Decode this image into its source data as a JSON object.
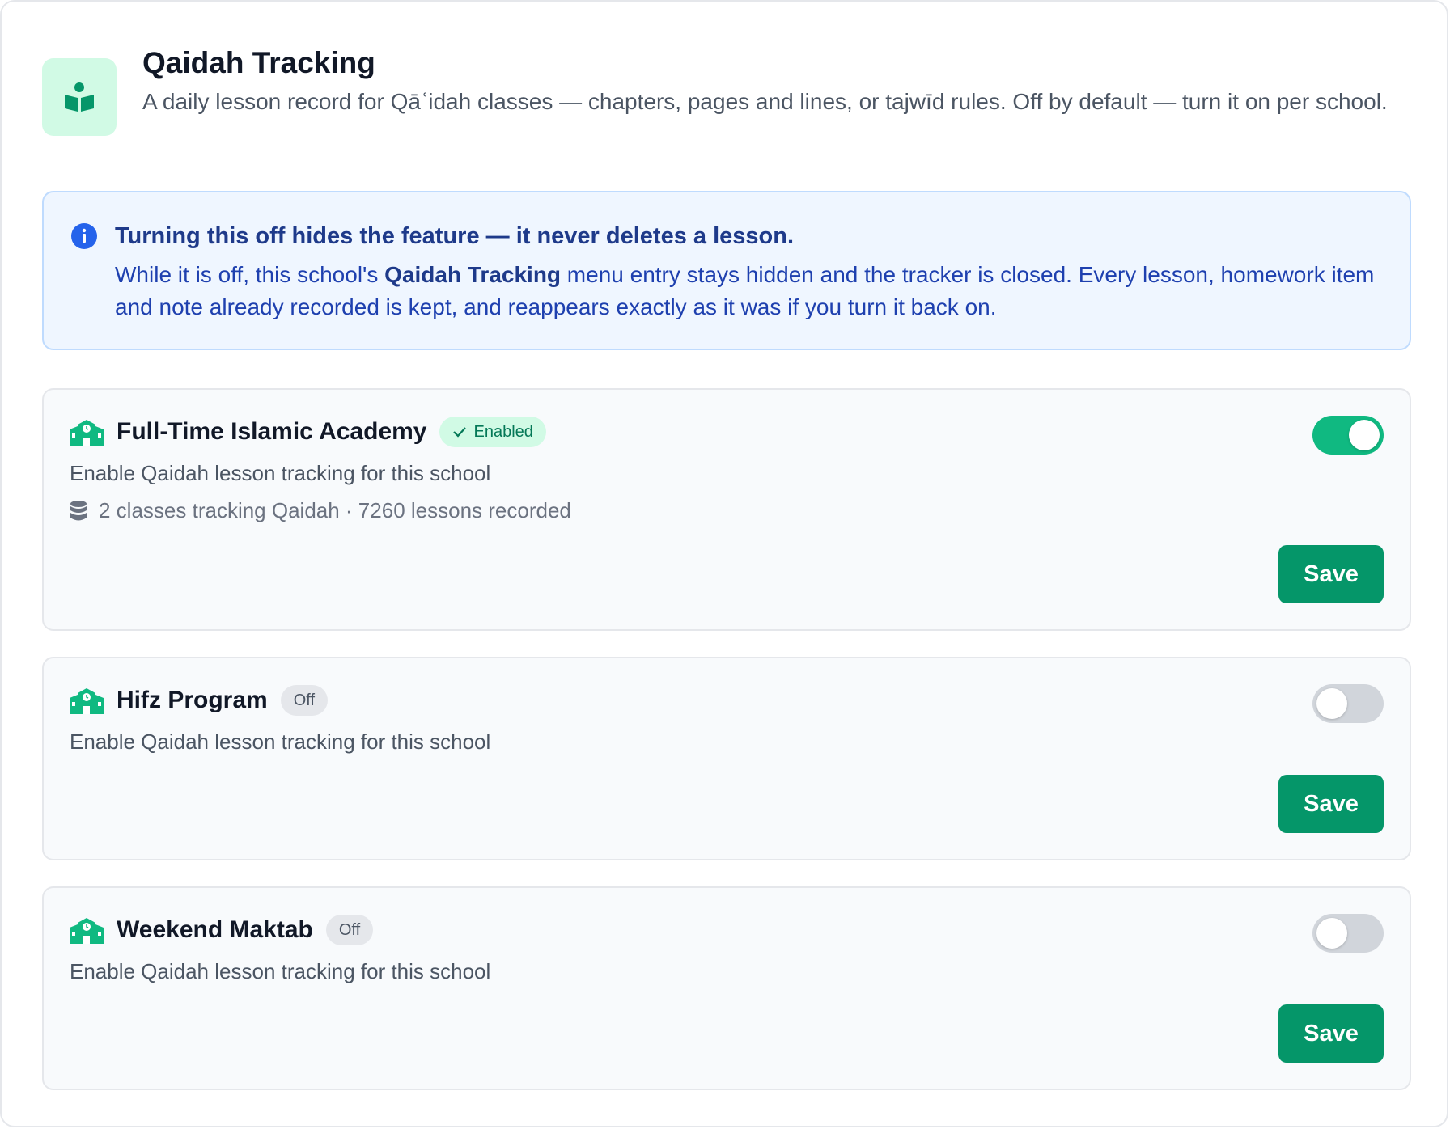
{
  "header": {
    "title": "Qaidah Tracking",
    "description": "A daily lesson record for Qāʿidah classes — chapters, pages and lines, or tajwīd rules. Off by default — turn it on per school.",
    "icon": "book-reader-icon"
  },
  "info": {
    "title": "Turning this off hides the feature — it never deletes a lesson.",
    "body_before": "While it is off, this school's ",
    "body_strong": "Qaidah Tracking",
    "body_after": " menu entry stays hidden and the tracker is closed. Every lesson, homework item and note already recorded is kept, and reappears exactly as it was if you turn it back on.",
    "icon": "info-icon"
  },
  "schools": [
    {
      "name": "Full-Time Islamic Academy",
      "badge": "Enabled",
      "enabled": true,
      "description": "Enable Qaidah lesson tracking for this school",
      "stats": "2 classes tracking Qaidah · 7260 lessons recorded",
      "save_label": "Save"
    },
    {
      "name": "Hifz Program",
      "badge": "Off",
      "enabled": false,
      "description": "Enable Qaidah lesson tracking for this school",
      "save_label": "Save"
    },
    {
      "name": "Weekend Maktab",
      "badge": "Off",
      "enabled": false,
      "description": "Enable Qaidah lesson tracking for this school",
      "save_label": "Save"
    }
  ],
  "colors": {
    "accent": "#059669",
    "toggle_on": "#10b981",
    "info_text": "#1e40af"
  }
}
